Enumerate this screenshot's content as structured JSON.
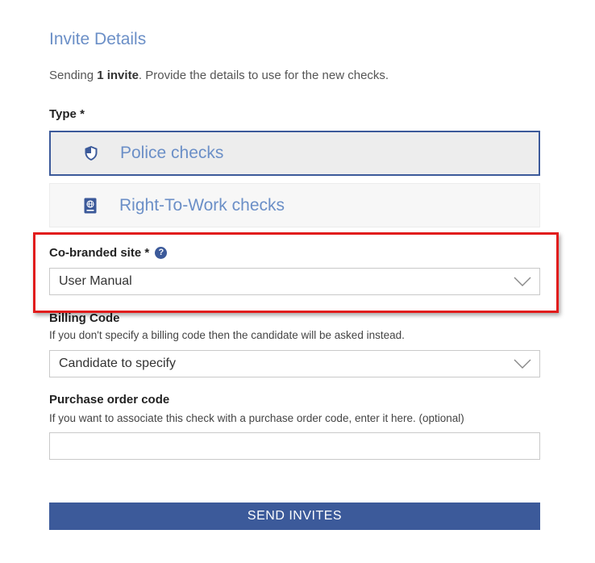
{
  "page": {
    "title": "Invite Details",
    "intro_prefix": "Sending ",
    "intro_count": "1 invite",
    "intro_suffix": ". Provide the details to use for the new checks."
  },
  "type_field": {
    "label": "Type *",
    "options": [
      {
        "label": "Police checks",
        "icon": "shield-icon",
        "selected": true
      },
      {
        "label": "Right-To-Work checks",
        "icon": "passport-icon",
        "selected": false
      }
    ]
  },
  "cobranded": {
    "label": "Co-branded site *",
    "help_icon": "?",
    "value": "User Manual"
  },
  "billing": {
    "label": "Billing Code",
    "help": "If you don't specify a billing code then the candidate will be asked instead.",
    "value": "Candidate to specify"
  },
  "purchase_order": {
    "label": "Purchase order code",
    "help": "If you want to associate this check with a purchase order code, enter it here. (optional)",
    "value": ""
  },
  "submit": {
    "label": "SEND INVITES"
  },
  "colors": {
    "accent": "#3c5a9a",
    "title_blue": "#6b8fc7",
    "highlight_red": "#e11c1c"
  }
}
